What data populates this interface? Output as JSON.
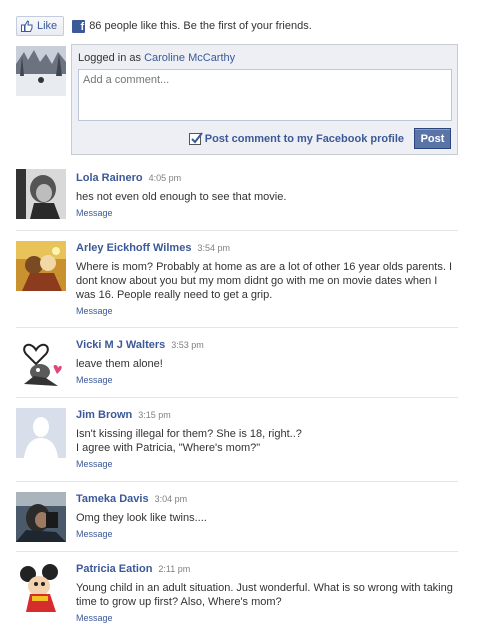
{
  "like_bar": {
    "like_label": "Like",
    "count_text": "86 people like this. Be the first of your friends."
  },
  "composer": {
    "logged_in_prefix": "Logged in as",
    "user_name": "Caroline McCarthy",
    "placeholder": "Add a comment...",
    "post_to_profile_label": "Post comment to my Facebook profile",
    "post_to_profile_checked": true,
    "post_button": "Post"
  },
  "colors": {
    "link": "#3b5998",
    "post_button": "#5b74a8",
    "composer_bg": "#edeff4"
  },
  "comments": [
    {
      "name": "Lola Rainero",
      "time": "4:05 pm",
      "text": "hes not even old enough to see that movie.",
      "action": "Message",
      "avatar": "bw-photo-avatar"
    },
    {
      "name": "Arley Eickhoff Wilmes",
      "time": "3:54 pm",
      "text": "Where is mom? Probably at home as are a lot of other 16 year olds parents. I dont know about you but my mom didnt go with me on movie dates when I was 16. People really need to get a grip.",
      "action": "Message",
      "avatar": "warm-photo-avatar"
    },
    {
      "name": "Vicki M J Walters",
      "time": "3:53 pm",
      "text": "leave them alone!",
      "action": "Message",
      "avatar": "cartoon-heart-avatar"
    },
    {
      "name": "Jim Brown",
      "time": "3:15 pm",
      "text": "Isn't kissing illegal for them? She is 18, right..?\nI agree with Patricia, \"Where's mom?\"",
      "action": "Message",
      "avatar": "default-silhouette-avatar"
    },
    {
      "name": "Tameka Davis",
      "time": "3:04 pm",
      "text": "Omg they look like twins....",
      "action": "Message",
      "avatar": "dark-photo-avatar"
    },
    {
      "name": "Patricia Eation",
      "time": "2:11 pm",
      "text": "Young child in an adult situation. Just wonderful. What is so wrong with taking time to grow up first? Also, Where's mom?",
      "action": "Message",
      "avatar": "cartoon-mouse-avatar"
    }
  ]
}
